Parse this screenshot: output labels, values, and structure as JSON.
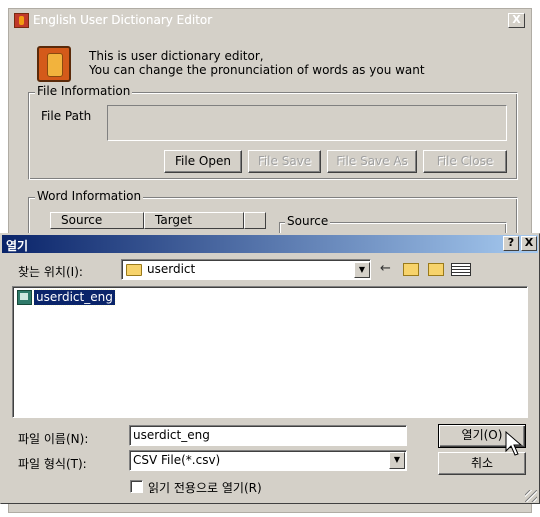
{
  "editor": {
    "title": "English User Dictionary Editor",
    "close_glyph": "X",
    "intro_text": "This is user dictionary editor,\nYou can change the pronunciation of words as you want",
    "file_info": {
      "legend": "File Information",
      "path_label": "File Path",
      "buttons": {
        "open": "File Open",
        "save": "File Save",
        "save_as": "File Save As",
        "close": "File Close"
      }
    },
    "word_info": {
      "legend": "Word Information",
      "columns": [
        "Source",
        "Target"
      ],
      "source_legend": "Source"
    }
  },
  "open_dialog": {
    "title": "열기",
    "help_glyph": "?",
    "close_glyph": "X",
    "look_in_label": "찾는 위치(I):",
    "look_in_value": "userdict",
    "files": [
      "userdict_eng"
    ],
    "filename_label": "파일 이름(N):",
    "filename_value": "userdict_eng",
    "filetype_label": "파일 형식(T):",
    "filetype_value": "CSV File(*.csv)",
    "readonly_label": "읽기 전용으로 열기(R)",
    "open_button": "열기(O)",
    "cancel_button": "취소",
    "icons": [
      "folder-icon",
      "back-arrow-icon",
      "up-folder-icon",
      "new-folder-icon",
      "view-menu-icon",
      "file-icon",
      "mouse-pointer-icon"
    ]
  }
}
